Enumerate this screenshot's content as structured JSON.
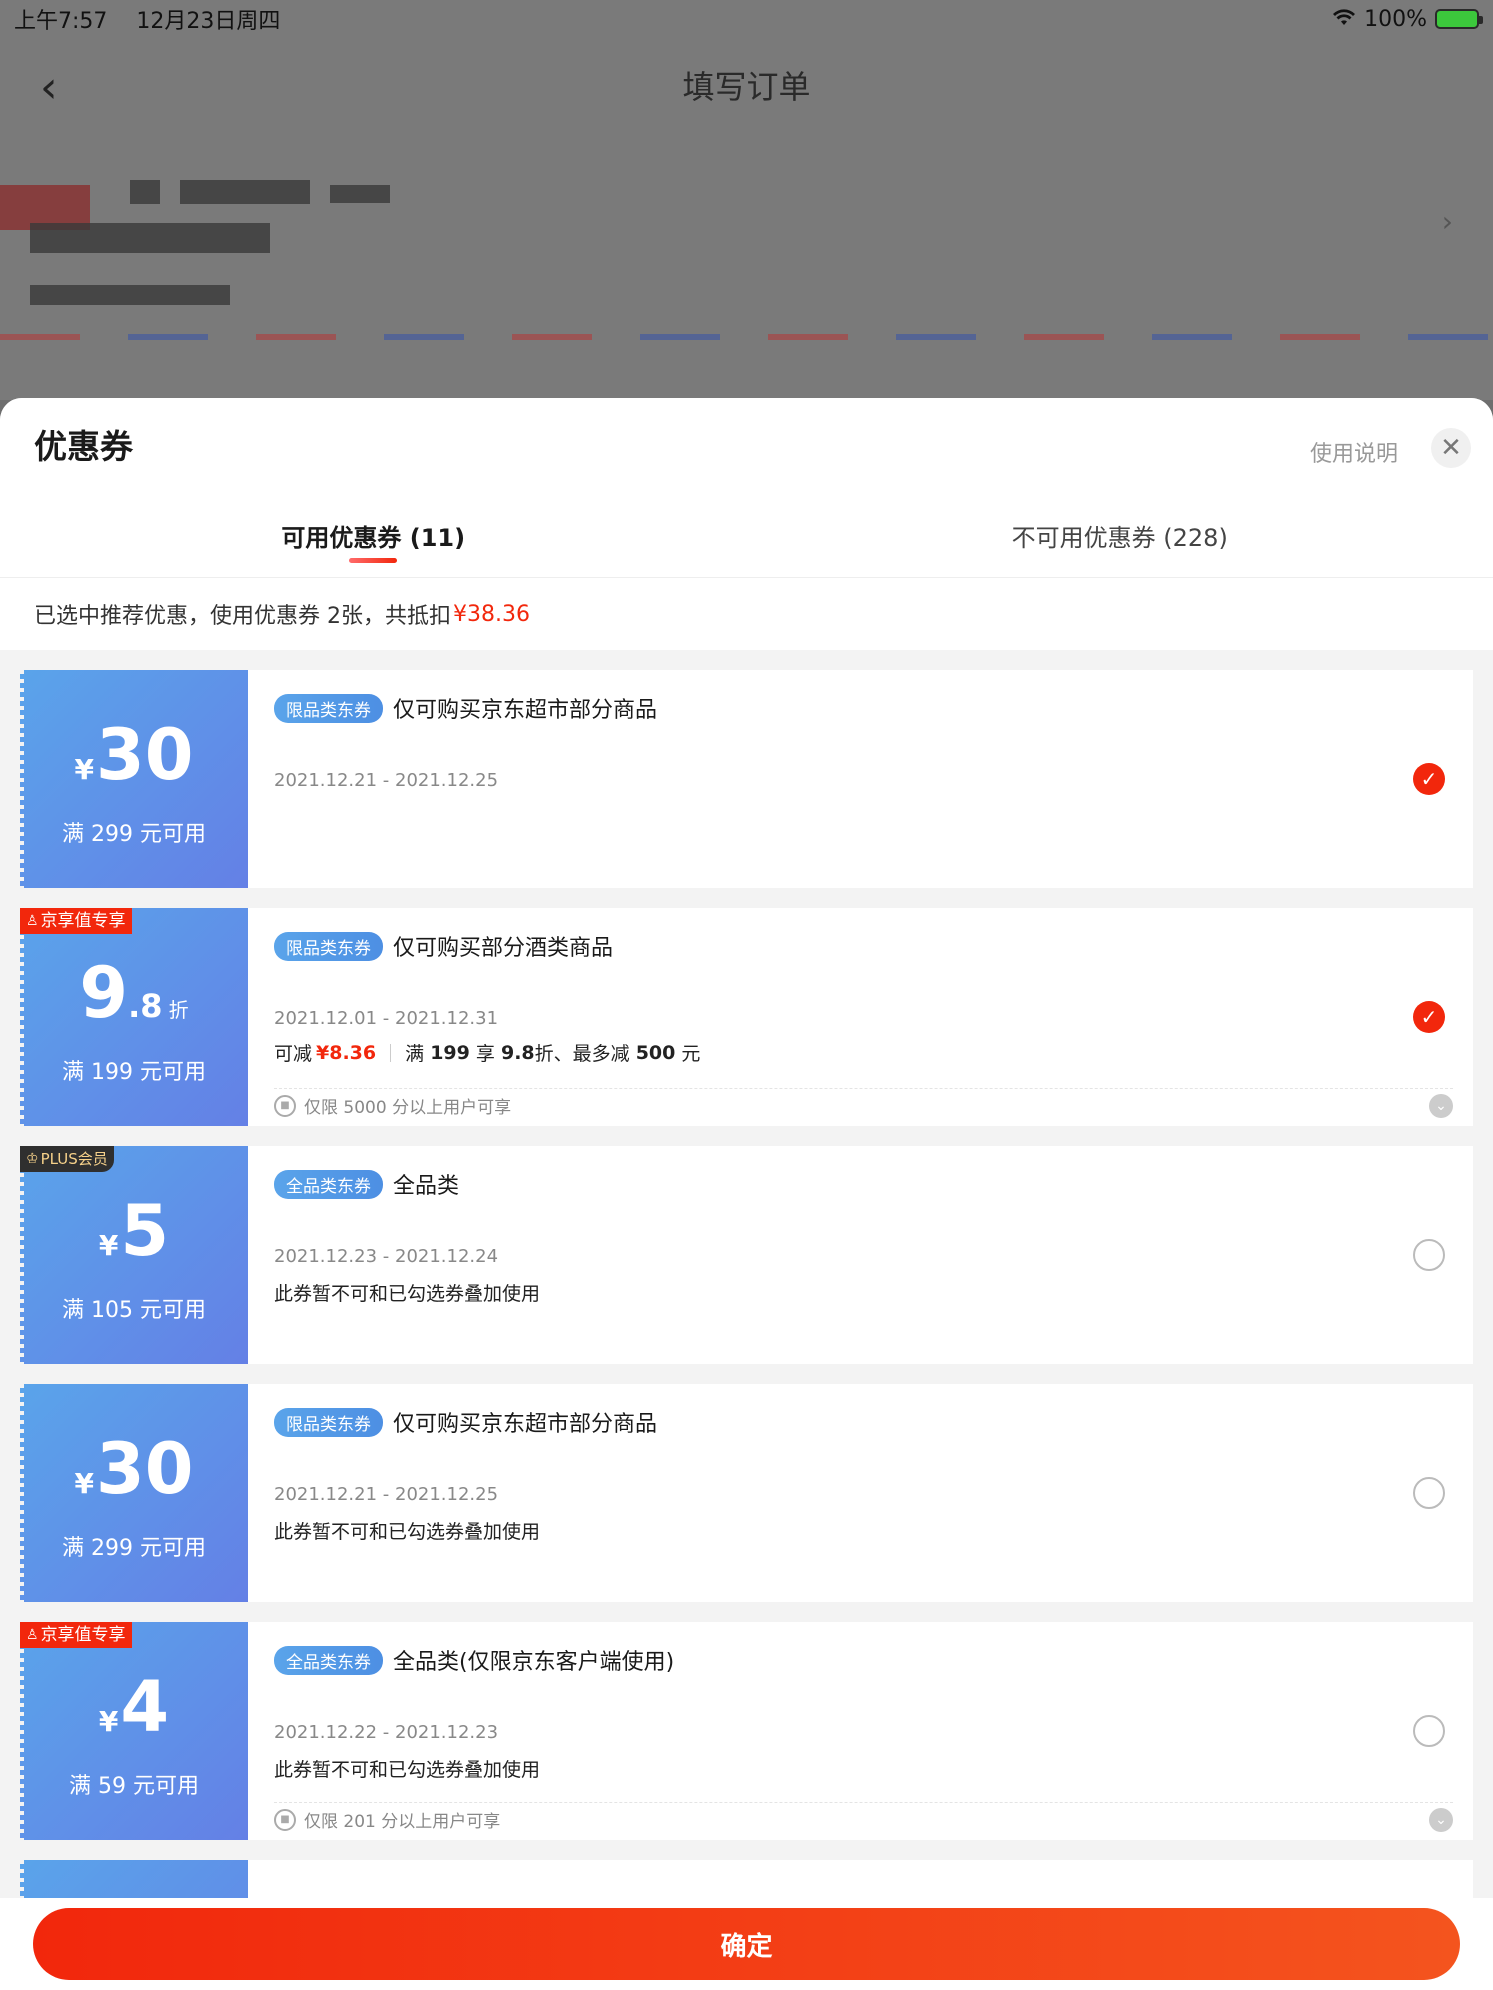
{
  "status_bar": {
    "time": "上午7:57",
    "date": "12月23日周四",
    "battery": "100%"
  },
  "nav": {
    "title": "填写订单"
  },
  "sheet": {
    "title": "优惠券",
    "help_label": "使用说明",
    "close_label": "✕"
  },
  "tabs": [
    {
      "label": "可用优惠券 (11)",
      "active": true
    },
    {
      "label": "不可用优惠券 (228)",
      "active": false
    }
  ],
  "summary": {
    "text": "已选中推荐优惠，使用优惠券 2张，共抵扣",
    "amount": "¥38.36"
  },
  "coupons": [
    {
      "ribbon": "",
      "currency": "¥",
      "value": "30",
      "threshold": "满 299 元可用",
      "tag": "限品类东券",
      "name": "仅可购买京东超市部分商品",
      "date": "2021.12.21 - 2021.12.25",
      "note": "",
      "checked": true
    },
    {
      "ribbon": "京享值专享",
      "value_int": "9",
      "value_dec": ".8",
      "unit": "折",
      "threshold": "满 199 元可用",
      "tag": "限品类东券",
      "name": "仅可购买部分酒类商品",
      "date": "2021.12.01 - 2021.12.31",
      "deduct_label": "可减",
      "deduct_amount": "¥8.36",
      "rule_prefix": "满",
      "rule_min": "199",
      "rule_mid": "享",
      "rule_rate": "9.8",
      "rule_mid2": "折、最多减",
      "rule_max": "500",
      "rule_suffix": "元",
      "restriction": "仅限 5000 分以上用户可享",
      "checked": true
    },
    {
      "ribbon": "PLUS会员",
      "currency": "¥",
      "value": "5",
      "threshold": "满 105 元可用",
      "tag": "全品类东券",
      "name": "全品类",
      "date": "2021.12.23 - 2021.12.24",
      "note": "此券暂不可和已勾选券叠加使用",
      "checked": false
    },
    {
      "ribbon": "",
      "currency": "¥",
      "value": "30",
      "threshold": "满 299 元可用",
      "tag": "限品类东券",
      "name": "仅可购买京东超市部分商品",
      "date": "2021.12.21 - 2021.12.25",
      "note": "此券暂不可和已勾选券叠加使用",
      "checked": false
    },
    {
      "ribbon": "京享值专享",
      "currency": "¥",
      "value": "4",
      "threshold": "满 59 元可用",
      "tag": "全品类东券",
      "name": "全品类(仅限京东客户端使用)",
      "date": "2021.12.22 - 2021.12.23",
      "note": "此券暂不可和已勾选券叠加使用",
      "restriction": "仅限 201 分以上用户可享",
      "checked": false
    }
  ],
  "confirm_label": "确定",
  "colors": {
    "accent": "#f2270c",
    "coupon_blue": "#5aa4ea"
  }
}
